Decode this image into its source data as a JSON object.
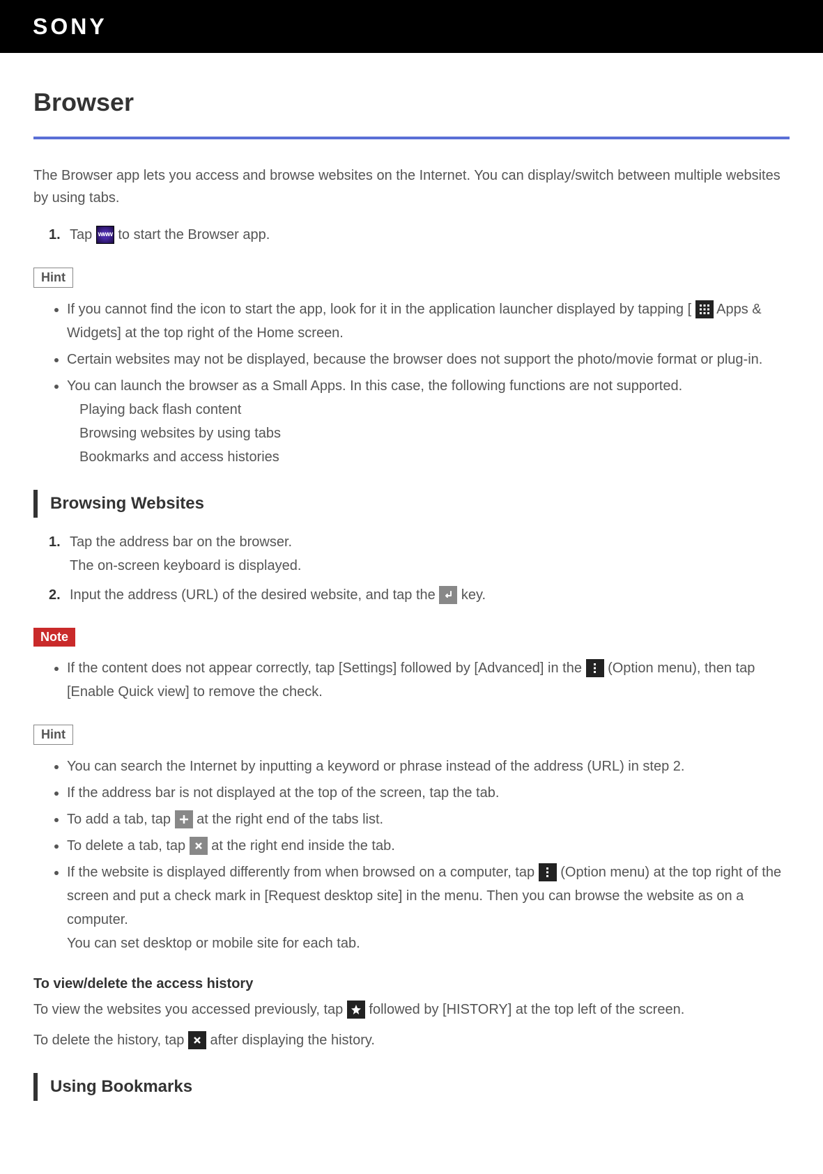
{
  "header": {
    "logo": "SONY"
  },
  "title": "Browser",
  "intro": "The Browser app lets you access and browse websites on the Internet. You can display/switch between multiple websites by using tabs.",
  "step1": {
    "num": "1.",
    "pre": "Tap ",
    "post": " to start the Browser app."
  },
  "hint1": {
    "label": "Hint",
    "b1_pre": "If you cannot find the icon to start the app, look for it in the application launcher displayed by tapping [",
    "b1_post": " Apps & Widgets] at the top right of the Home screen.",
    "b2": "Certain websites may not be displayed, because the browser does not support the photo/movie format or plug-in.",
    "b3": "You can launch the browser as a Small Apps. In this case, the following functions are not supported.",
    "b3s1": "Playing back flash content",
    "b3s2": "Browsing websites by using tabs",
    "b3s3": "Bookmarks and access histories"
  },
  "sec2": {
    "heading": "Browsing Websites",
    "s1num": "1.",
    "s1a": "Tap the address bar on the browser.",
    "s1b": "The on-screen keyboard is displayed.",
    "s2num": "2.",
    "s2pre": "Input the address (URL) of the desired website, and tap the ",
    "s2post": " key."
  },
  "note1": {
    "label": "Note",
    "pre": "If the content does not appear correctly, tap [Settings] followed by [Advanced] in the ",
    "post": " (Option menu), then tap [Enable Quick view] to remove the check."
  },
  "hint2": {
    "label": "Hint",
    "b1": "You can search the Internet by inputting a keyword or phrase instead of the address (URL) in step 2.",
    "b2": "If the address bar is not displayed at the top of the screen, tap the tab.",
    "b3pre": "To add a tab, tap ",
    "b3post": " at the right end of the tabs list.",
    "b4pre": "To delete a tab, tap ",
    "b4post": " at the right end inside the tab.",
    "b5pre": "If the website is displayed differently from when browsed on a computer, tap ",
    "b5post": " (Option menu) at the top right of the screen and put a check mark in [Request desktop site] in the menu. Then you can browse the website as on a computer.",
    "b5sub": "You can set desktop or mobile site for each tab."
  },
  "history": {
    "heading": "To view/delete the access history",
    "p1pre": "To view the websites you accessed previously, tap ",
    "p1post": " followed by [HISTORY] at the top left of the screen.",
    "p2pre": "To delete the history, tap ",
    "p2post": " after displaying the history."
  },
  "sec3": {
    "heading": "Using Bookmarks"
  }
}
